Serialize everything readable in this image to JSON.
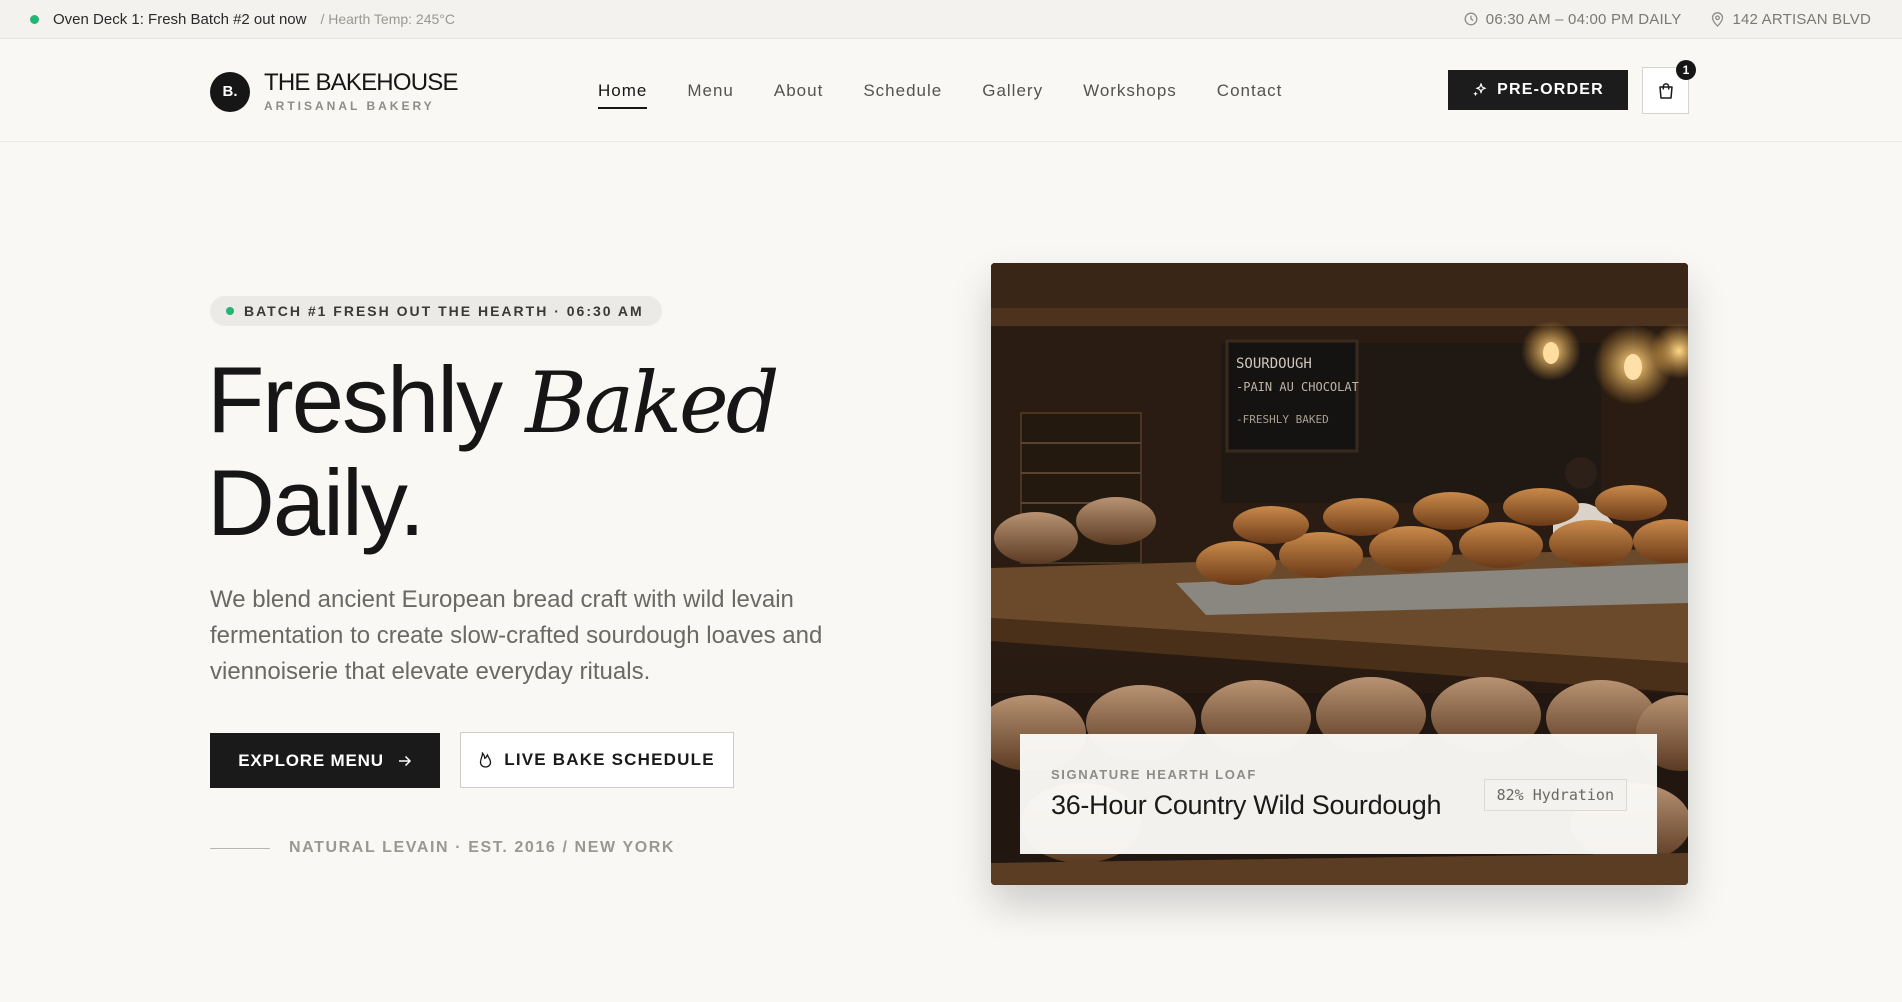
{
  "topbar": {
    "status": "Oven Deck 1: Fresh Batch #2 out now",
    "temp": "/ Hearth Temp: 245°C",
    "hours": "06:30 AM – 04:00 PM DAILY",
    "address": "142 ARTISAN BLVD",
    "icons": [
      "clock-icon",
      "map-pin-icon"
    ],
    "status_color": "#22b573"
  },
  "header": {
    "logo_mark": "B.",
    "brand": "THE BAKEHOUSE",
    "tagline": "ARTISANAL BAKERY",
    "nav": [
      {
        "label": "Home",
        "active": true
      },
      {
        "label": "Menu"
      },
      {
        "label": "About"
      },
      {
        "label": "Schedule"
      },
      {
        "label": "Gallery"
      },
      {
        "label": "Workshops"
      },
      {
        "label": "Contact"
      }
    ],
    "preorder_label": "PRE-ORDER",
    "cart_count": "1"
  },
  "hero": {
    "badge": "BATCH #1 FRESH OUT THE HEARTH · 06:30 AM",
    "headline_part1": "Freshly",
    "headline_italic": "Baked",
    "headline_part2": "Daily.",
    "lede": "We blend ancient European bread craft with wild levain fermentation to create slow-crafted sourdough loaves and viennoiserie that elevate everyday rituals.",
    "primary_cta": "EXPLORE MENU",
    "secondary_cta": "LIVE BAKE SCHEDULE",
    "footnote": "NATURAL LEVAIN · EST. 2016 / NEW YORK"
  },
  "feature": {
    "chalkboard": [
      "SOURDOUGH",
      "-PAIN AU CHOCOLAT",
      "-FRESHLY BAKED"
    ],
    "kicker": "SIGNATURE HEARTH LOAF",
    "title": "36-Hour Country Wild Sourdough",
    "tag": "82% Hydration"
  },
  "colors": {
    "background": "#f9f8f5",
    "ink": "#161616",
    "accent_green": "#22b573"
  }
}
